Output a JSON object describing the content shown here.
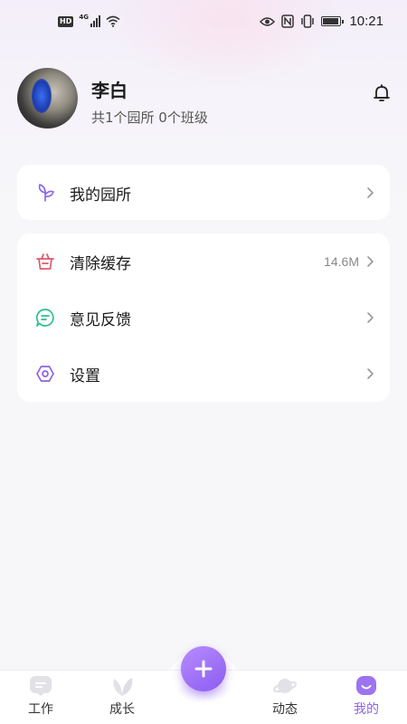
{
  "status_bar": {
    "hd": "HD",
    "network": "4G",
    "time": "10:21",
    "icons": [
      "signal-icon",
      "wifi-icon",
      "eye-icon",
      "nfc-icon",
      "vibrate-icon",
      "battery-icon"
    ]
  },
  "profile": {
    "name": "李白",
    "summary": "共1个园所 0个班级",
    "notification_icon": "bell-icon"
  },
  "menu_group_1": {
    "items": [
      {
        "label": "我的园所",
        "icon": "sprout-icon",
        "icon_color": "#8c62e8"
      }
    ]
  },
  "menu_group_2": {
    "items": [
      {
        "label": "清除缓存",
        "icon": "basket-icon",
        "icon_color": "#e0586b",
        "value": "14.6M"
      },
      {
        "label": "意见反馈",
        "icon": "chat-icon",
        "icon_color": "#2bbf8f"
      },
      {
        "label": "设置",
        "icon": "hex-gear-icon",
        "icon_color": "#8c62e8"
      }
    ]
  },
  "tabbar": {
    "tabs": [
      {
        "label": "工作",
        "icon": "chat-bubble-icon",
        "active": false
      },
      {
        "label": "成长",
        "icon": "leaf-icon",
        "active": false
      },
      {
        "label": "动态",
        "icon": "planet-icon",
        "active": false
      },
      {
        "label": "我的",
        "icon": "smile-icon",
        "active": true
      }
    ],
    "center_icon": "plus-icon"
  },
  "colors": {
    "accent": "#8c62e8",
    "card_bg": "#ffffff",
    "page_bg": "#f7f7f9"
  }
}
